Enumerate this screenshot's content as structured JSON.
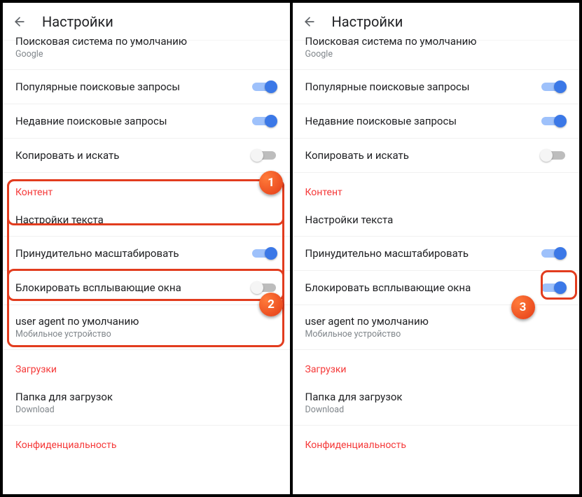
{
  "appbar": {
    "title": "Настройки"
  },
  "sections": {
    "defaultSearch": {
      "title": "Поисковая система по умолчанию",
      "value": "Google"
    },
    "popularQueries": "Популярные поисковые запросы",
    "recentQueries": "Недавние поисковые запросы",
    "copySearch": "Копировать и искать",
    "contentHeader": "Контент",
    "textSettings": "Настройки текста",
    "forceZoom": "Принудительно масштабировать",
    "blockPopups": "Блокировать всплывающие окна",
    "userAgent": {
      "title": "user agent по умолчанию",
      "value": "Мобильное устройство"
    },
    "downloadsHeader": "Загрузки",
    "downloadFolder": {
      "title": "Папка для загрузок",
      "value": "Download"
    },
    "privacyHeader": "Конфиденциальность"
  },
  "markers": {
    "m1": "1",
    "m2": "2",
    "m3": "3"
  }
}
